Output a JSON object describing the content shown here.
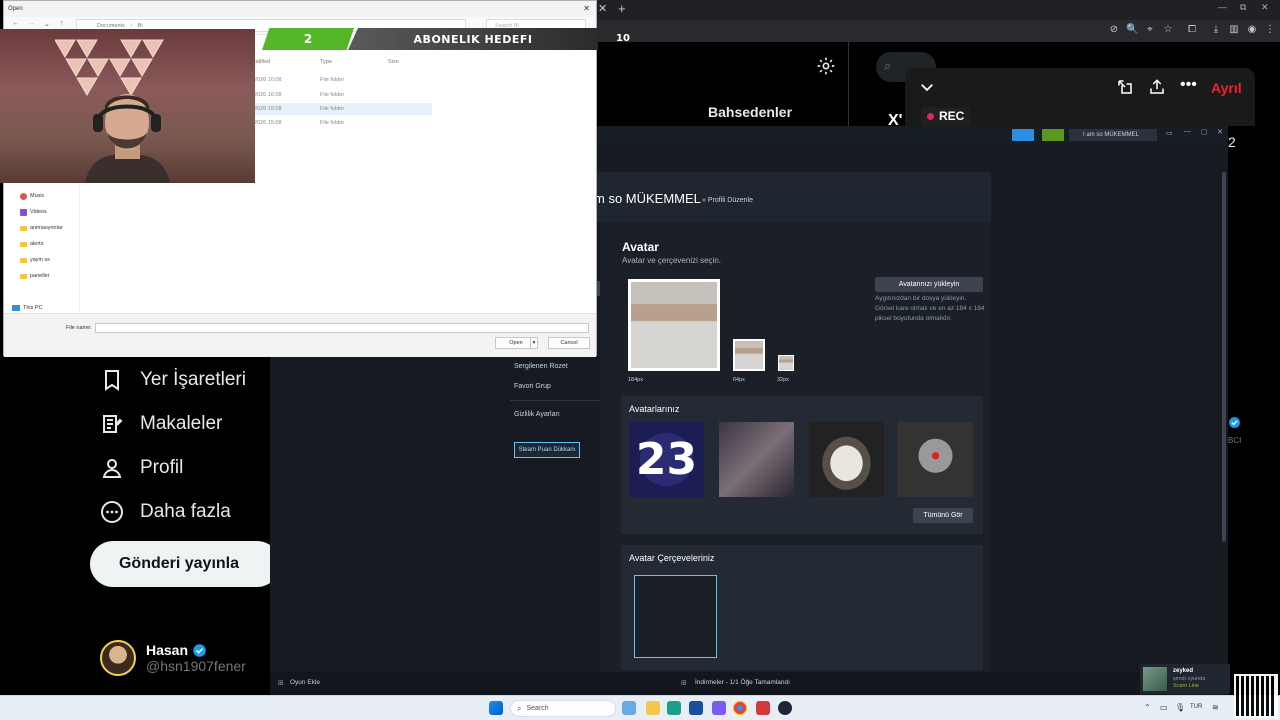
{
  "file_dialog": {
    "title": "Open",
    "breadcrumb": [
      "Documents",
      "Bi"
    ],
    "search_placeholder": "Search Bi",
    "columns": {
      "modified": "odified",
      "type": "Type",
      "size": "Size"
    },
    "rows": [
      {
        "modified": "2026 16:08",
        "type": "File folder"
      },
      {
        "modified": "2026 16:08",
        "type": "File folder"
      },
      {
        "modified": "2026 16:08",
        "type": "File folder"
      },
      {
        "modified": "2026 15:08",
        "type": "File folder"
      }
    ],
    "sidebar": [
      "Music",
      "Videos",
      "animasyonlar",
      "alerts",
      "yayin ss",
      "paneller",
      "This PC"
    ],
    "filename_label": "File name:",
    "open_label": "Open",
    "cancel_label": "Cancel"
  },
  "sub_goal": {
    "count": "2",
    "label": "ABONELIK HEDEFI",
    "target": "10"
  },
  "x_sidebar": {
    "items": [
      {
        "label": "Yer İşaretleri",
        "icon": "bookmark-icon"
      },
      {
        "label": "Makaleler",
        "icon": "articles-icon"
      },
      {
        "label": "Profil",
        "icon": "profile-icon"
      },
      {
        "label": "Daha fazla",
        "icon": "more-icon"
      }
    ],
    "post_label": "Gönderi yayınla",
    "user_name": "Hasan",
    "user_handle": "@hsn1907fener"
  },
  "x_page": {
    "tab_mentions": "Bahsedenler",
    "rec_label": "REC",
    "leave_label": "Ayrıl",
    "partial_text": "X'",
    "side_number": "2",
    "side_label": "BCI"
  },
  "steam": {
    "account_label": "I am so MÜKEMMEL",
    "profile_name": "m so MÜKEMMEL",
    "breadcrumb": "» Profili Düzenle",
    "menu": [
      "Sergilenen Rozet",
      "Favori Grup",
      "Gizlilik Ayarları"
    ],
    "points_shop_label": "Steam Puan Dükkanı",
    "avatar_title": "Avatar",
    "avatar_subtitle": "Avatar ve çerçevenizi seçin.",
    "upload_label": "Avatarınızı yükleyin",
    "upload_help": "Aygıtınızdan bir dosya yükleyin. Görsel kare olmalı ve en az 184 x 184 piksel boyutunda olmalıdır.",
    "sizes": [
      "184px",
      "64px",
      "32px"
    ],
    "your_avatars_title": "Avatarlarınız",
    "tile_number": "23",
    "see_all_label": "Tümünü Gör",
    "frames_title": "Avatar Çerçeveleriniz",
    "footer_add_game": "Oyun Ekle",
    "footer_downloads": "İndirmeler - 1/1 Öğe Tamamlandı"
  },
  "friend_toast": {
    "name": "zeyked",
    "status": "şimdi oyunda",
    "game": "Scam Line"
  },
  "taskbar": {
    "search_placeholder": "Search",
    "lang": "TUR"
  },
  "colors": {
    "steam_accent": "#67c1f5",
    "goal_green": "#53b728",
    "x_verified": "#1d9bf0",
    "leave_red": "#f4212e"
  }
}
